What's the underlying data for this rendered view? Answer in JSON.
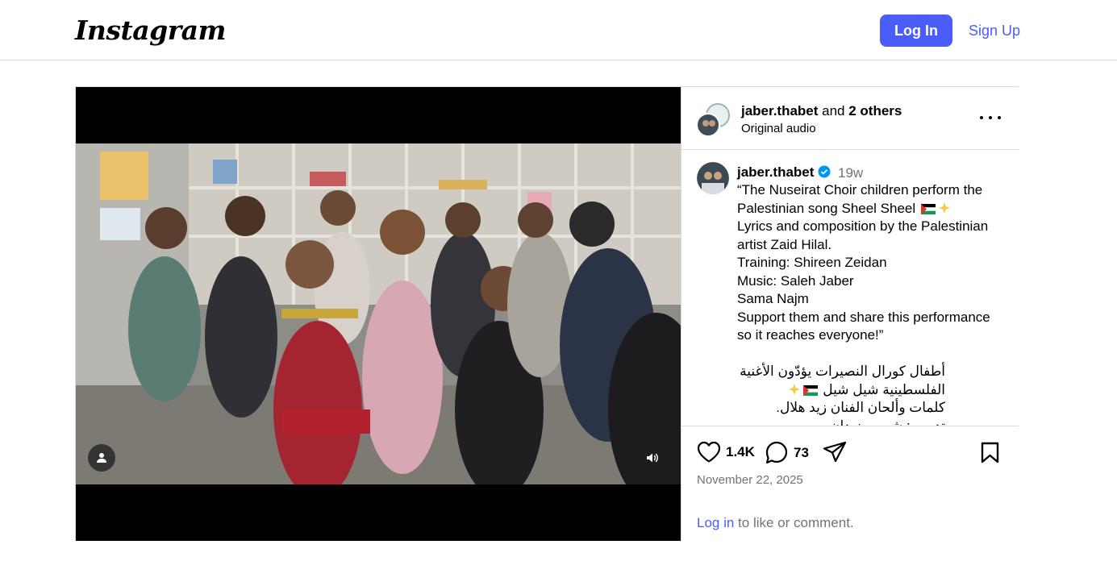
{
  "app": {
    "logo_text": "Instagram"
  },
  "topbar": {
    "login_label": "Log In",
    "signup_label": "Sign Up",
    "accent": "#4a5df9"
  },
  "post": {
    "header": {
      "username": "jaber.thabet",
      "and_text": " and ",
      "others_text": "2 others",
      "audio_label": "Original audio"
    },
    "caption": {
      "username": "jaber.thabet",
      "time_ago": "19w",
      "lines": {
        "l1": "“The Nuseirat Choir children perform the",
        "l2": "Palestinian song Sheel Sheel",
        "l3": "Lyrics and composition by the Palestinian",
        "l4": "artist Zaid Hilal.",
        "l5": "Training: Shireen Zeidan",
        "l6": "Music: Saleh Jaber",
        "l7": "Sama Najm",
        "l8": "Support them and share this performance",
        "l9": "so it reaches everyone!”",
        "ar1": "أطفال كورال النصيرات يؤدّون الأغنية",
        "ar2": "الفلسطينية شيل شيل",
        "ar3": "كلمات وألحان الفنان زيد هلال.",
        "ar4": "تدريب: شيرين زيدان"
      }
    },
    "actions": {
      "likes": "1.4K",
      "comments": "73"
    },
    "date": "November 22, 2025",
    "login_prompt": {
      "link": "Log in",
      "rest": " to like or comment."
    },
    "icons": [
      "user-tag-icon",
      "volume-icon",
      "more-icon",
      "verified-icon",
      "heart-icon",
      "comment-icon",
      "share-icon",
      "bookmark-icon"
    ]
  }
}
